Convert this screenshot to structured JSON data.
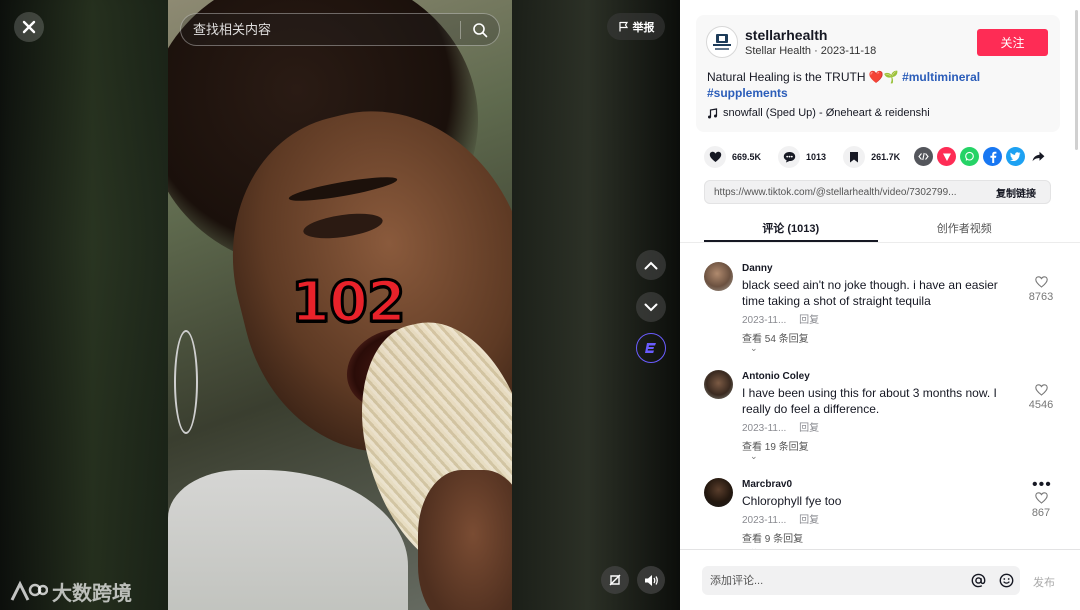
{
  "player": {
    "overlay_number": "102",
    "search_placeholder": "查找相关内容",
    "report_label": "举报"
  },
  "watermark": {
    "text": "大数跨境"
  },
  "author": {
    "username": "stellarhealth",
    "display_name": "Stellar Health",
    "date": "2023-11-18",
    "subline": "Stellar Health · 2023-11-18",
    "follow_label": "关注",
    "description_prefix": "Natural Healing is the TRUTH ❤️🌱 ",
    "hashtag_1": "#multimineral",
    "hashtag_2": "#supplements",
    "music": "snowfall (Sped Up) - Øneheart & reidenshi"
  },
  "stats": {
    "likes": "669.5K",
    "comments": "1013",
    "saves": "261.7K"
  },
  "share": {
    "url": "https://www.tiktok.com/@stellarhealth/video/7302799...",
    "copy_label": "复制链接"
  },
  "tabs": [
    {
      "label": "评论 (1013)"
    },
    {
      "label": "创作者视频"
    }
  ],
  "comments": [
    {
      "user": "Danny",
      "text": "black seed ain't no joke though. i have an easier time taking a shot of straight tequila",
      "date": "2023-11...",
      "reply_label": "回复",
      "replies": "查看 54 条回复",
      "likes": "8763"
    },
    {
      "user": "Antonio Coley",
      "text": "I have been using this for about 3 months now. I really do feel a difference.",
      "date": "2023-11...",
      "reply_label": "回复",
      "replies": "查看 19 条回复",
      "likes": "4546"
    },
    {
      "user": "Marcbrav0",
      "text": "Chlorophyll fye too",
      "date": "2023-11...",
      "reply_label": "回复",
      "replies": "查看 9 条回复",
      "likes": "867"
    }
  ],
  "comment_input": {
    "placeholder": "添加评论...",
    "post_label": "发布"
  },
  "colors": {
    "accent": "#fe2c55",
    "hashtag": "#2b5db9",
    "brand_ring": "#6a5cff"
  }
}
